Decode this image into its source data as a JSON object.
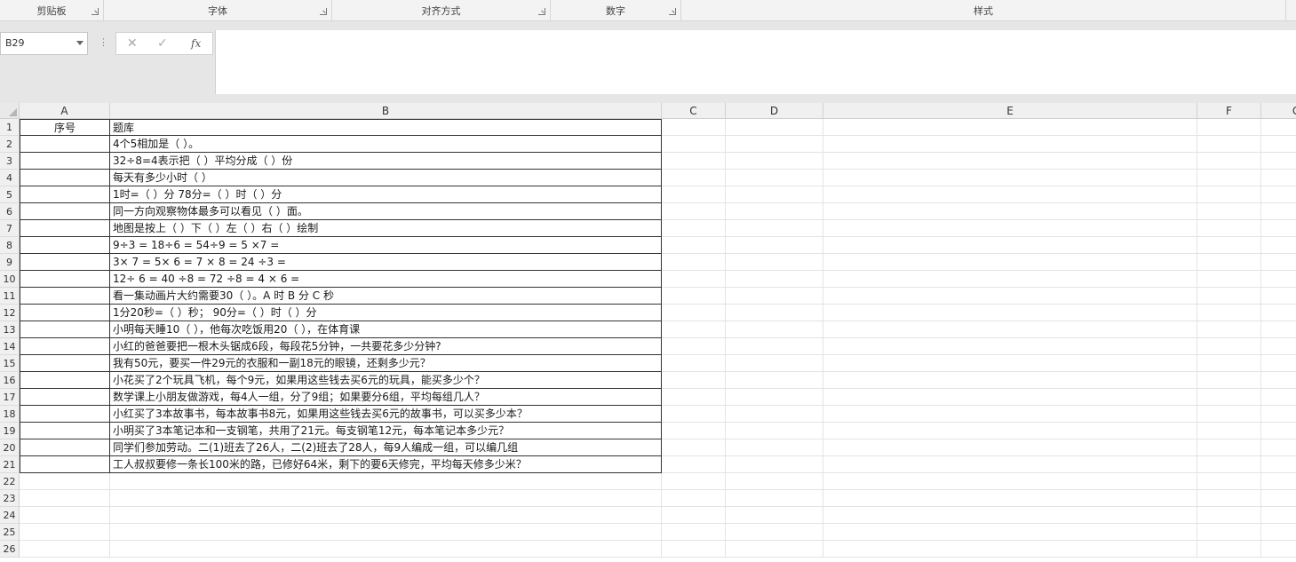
{
  "ribbon": {
    "groups": [
      {
        "label": "剪贴板"
      },
      {
        "label": "字体"
      },
      {
        "label": "对齐方式"
      },
      {
        "label": "数字"
      },
      {
        "label": "样式"
      }
    ]
  },
  "formula_bar": {
    "name_box": "B29",
    "cancel_icon": "✕",
    "enter_icon": "✓",
    "fx_label": "fx",
    "formula_value": ""
  },
  "sheet": {
    "columns": [
      "A",
      "B",
      "C",
      "D",
      "E",
      "F",
      "G"
    ],
    "row_numbers": [
      "1",
      "2",
      "3",
      "4",
      "5",
      "6",
      "7",
      "8",
      "9",
      "10",
      "11",
      "12",
      "13",
      "14",
      "15",
      "16",
      "17",
      "18",
      "19",
      "20",
      "21",
      "22",
      "23",
      "24",
      "25",
      "26"
    ],
    "header_row": {
      "A": "序号",
      "B": "题库"
    },
    "questions": [
      "4个5相加是（  ）。",
      "32÷8=4表示把（   ）平均分成（   ）份",
      "每天有多少小时（    ）",
      "1时=（  ）分    78分=（   ）时（   ）分",
      "同一方向观察物体最多可以看见（   ）面。",
      "地图是按上（   ）下（   ）左（   ）右（   ）绘制",
      "9÷3 =        18÷6 =         54÷9 =        5 ×7 =",
      "3× 7 =        5× 6 =         7 × 8 =       24 ÷3 =",
      "12÷ 6 =        40 ÷8 =        72 ÷8 =       4 × 6 =",
      "看一集动画片大约需要30（   ）。A    时          B   分           C  秒",
      "1分20秒=（  ）秒；  90分=（  ）时（  ）分",
      "小明每天睡10（   ），他每次吃饭用20（    ），在体育课",
      "小红的爸爸要把一根木头锯成6段，每段花5分钟，一共要花多少分钟?",
      "我有50元，要买一件29元的衣服和一副18元的眼镜，还剩多少元？",
      "小花买了2个玩具飞机，每个9元，如果用这些钱去买6元的玩具，能买多少个？",
      "数学课上小朋友做游戏，每4人一组，分了9组；如果要分6组，平均每组几人？",
      "小红买了3本故事书，每本故事书8元，如果用这些钱去买6元的故事书，可以买多少本？",
      "小明买了3本笔记本和一支钢笔，共用了21元。每支钢笔12元，每本笔记本多少元？",
      "同学们参加劳动。二(1)班去了26人，二(2)班去了28人，每9人编成一组，可以编几组",
      "工人叔叔要修一条长100米的路，已修好64米，剩下的要6天修完，平均每天修多少米？"
    ]
  }
}
